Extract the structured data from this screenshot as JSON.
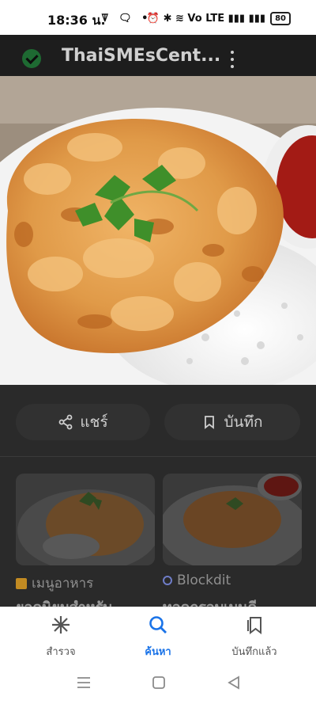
{
  "status_bar": {
    "time": "18:36 น.",
    "left_icons": "ꘜ 🗨 •",
    "right_icons": "⏰ ✱ ≋ Vo LTE ▮▮▮ ▮▮▮",
    "battery": "80"
  },
  "header": {
    "site_title": "ThaiSMEsCent...",
    "accent": "#1e6a32"
  },
  "actions": {
    "share_label": "แชร์",
    "save_label": "บันทึก"
  },
  "related": [
    {
      "source": "เมนูอาหาร",
      "caption": "ยอดนิยมสำหรับ"
    },
    {
      "source": "Blockdit",
      "caption": "ทอดกรอบเมนูดี"
    }
  ],
  "bottom_nav": {
    "explore": "สำรวจ",
    "search": "ค้นหา",
    "saved": "บันทึกแล้ว",
    "active_color": "#1a73e8"
  }
}
